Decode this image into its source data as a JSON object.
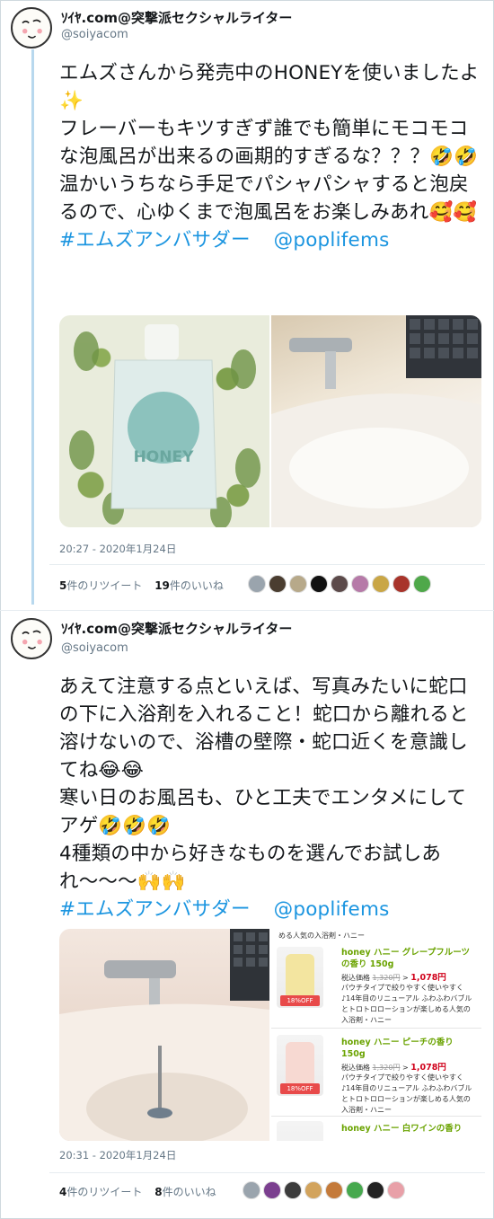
{
  "tweets": [
    {
      "author_name": "ｿｲﾔ.com@突撃派セクシャルライター",
      "handle": "@soiyacom",
      "text": "エムズさんから発売中のHONEYを使いましたよ✨\nフレーバーもキツすぎず誰でも簡単にモコモコな泡風呂が出来るの画期的すぎるな？？？🤣🤣\n温かいうちなら手足でパシャパシャすると泡戻るので、心ゆくまで泡風呂をお楽しみあれ🥰🥰",
      "hashtag": "#エムズアンバサダー",
      "mention": "@poplifems",
      "timestamp": "20:27 - 2020年1月24日",
      "retweet_count": "5",
      "retweet_label": "件のリツイート",
      "like_count": "19",
      "like_label": "件のいいね",
      "image_labels": [
        "HONEY"
      ]
    },
    {
      "author_name": "ｿｲﾔ.com@突撃派セクシャルライター",
      "handle": "@soiyacom",
      "text": "あえて注意する点といえば、写真みたいに蛇口の下に入浴剤を入れること！蛇口から離れると溶けないので、浴槽の壁際・蛇口近くを意識してね😂😂\n寒い日のお風呂も、ひと工夫でエンタメにしてアゲ🤣🤣🤣\n4種類の中から好きなものを選んでお試しあれ〜〜〜🙌🙌",
      "hashtag": "#エムズアンバサダー",
      "mention": "@poplifems",
      "timestamp": "20:31 - 2020年1月24日",
      "retweet_count": "4",
      "retweet_label": "件のリツイート",
      "like_count": "8",
      "like_label": "件のいいね",
      "product_list": {
        "top_snippet": "める人気の入浴剤・ハニー",
        "items": [
          {
            "name": "honey ハニー グレープフルーツの香り 150g",
            "price_label": "税込価格",
            "old_price": "1,320円",
            "arrow": ">",
            "new_price": "1,078円",
            "badge": "18%OFF",
            "desc": "パウチタイプで絞りやすく使いやすく♪14年目のリニューアル ふわふわバブルとトロトロローションが楽しめる人気の入浴剤・ハニー"
          },
          {
            "name": "honey ハニー ピーチの香り 150g",
            "price_label": "税込価格",
            "old_price": "1,320円",
            "arrow": ">",
            "new_price": "1,078円",
            "badge": "18%OFF",
            "desc": "パウチタイプで絞りやすく使いやすく♪14年目のリニューアル ふわふわバブルとトロトロローションが楽しめる人気の入浴剤・ハニー"
          },
          {
            "name": "honey ハニー 白ワインの香り"
          }
        ]
      }
    }
  ],
  "colors": {
    "link": "#1b95e0",
    "thread_line": "#b8d8ee",
    "product_name": "#6aa300",
    "sale_price": "#d0021b",
    "badge": "#e84a4a"
  }
}
